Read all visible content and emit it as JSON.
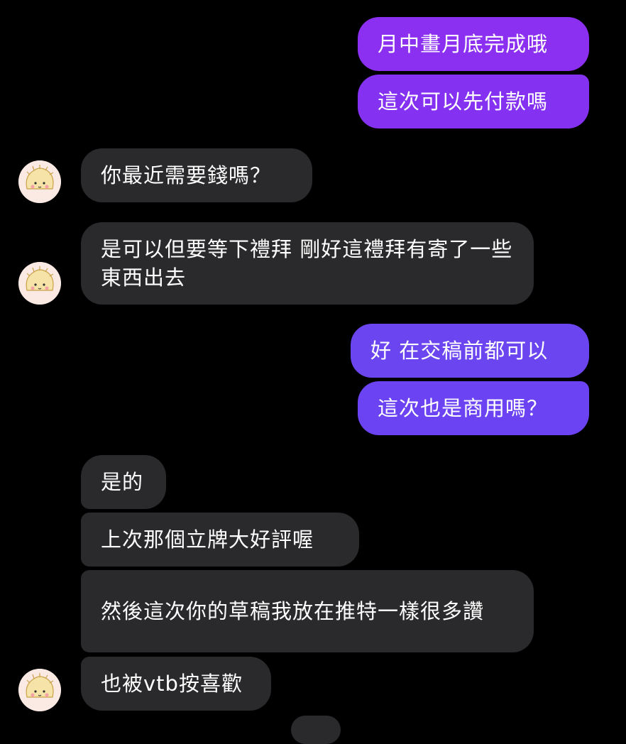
{
  "conversation": {
    "messages": [
      {
        "text": "月中畫月底完成哦",
        "side": "sent",
        "color": "#8b2ff0"
      },
      {
        "text": "這次可以先付款嗎",
        "side": "sent",
        "color": "#8431f2"
      },
      {
        "text": "你最近需要錢嗎？",
        "side": "received"
      },
      {
        "text": "是可以但要等下禮拜 剛好這禮拜有寄了一些東西出去",
        "side": "received"
      },
      {
        "text": "好 在交稿前都可以",
        "side": "sent",
        "color": "#6a45f0"
      },
      {
        "text": "這次也是商用嗎？",
        "side": "sent",
        "color": "#6b43f2"
      },
      {
        "text": "是的",
        "side": "received"
      },
      {
        "text": "上次那個立牌大好評喔",
        "side": "received"
      },
      {
        "text": "然後這次你的草稿我放在推特一樣很多讚",
        "side": "received"
      },
      {
        "text": "也被vtb按喜歡",
        "side": "received"
      }
    ]
  }
}
